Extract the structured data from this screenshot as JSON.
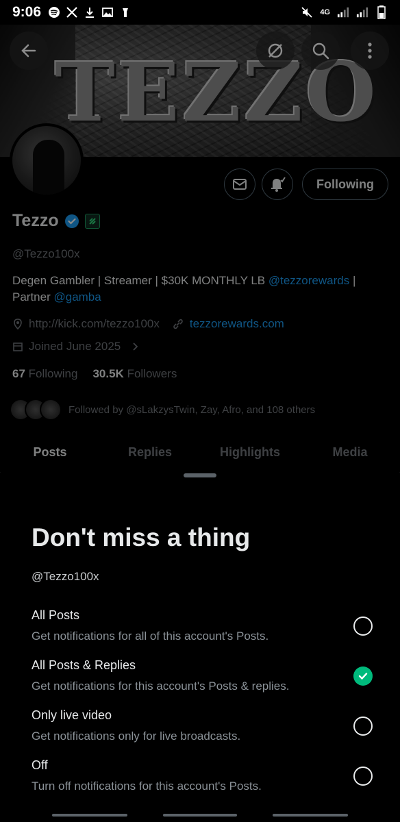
{
  "status_bar": {
    "time": "9:06",
    "network": "4G"
  },
  "profile": {
    "name": "Tezzo",
    "handle": "@Tezzo100x",
    "banner_text": "TEZZO",
    "following_button": "Following",
    "bio_text_1": "Degen Gambler | Streamer | $30K MONTHLY LB ",
    "bio_link_1": "@tezzorewards",
    "bio_text_2": " | Partner ",
    "bio_link_2": "@gamba",
    "url": "http://kick.com/tezzo100x",
    "website": "tezzorewards.com",
    "joined": "Joined June 2025",
    "following_count": "67",
    "following_label": "Following",
    "followers_count": "30.5K",
    "followers_label": "Followers",
    "followed_by": "Followed by @sLakzysTwin, Zay, Afro, and 108 others"
  },
  "tabs": [
    {
      "label": "Posts",
      "active": true
    },
    {
      "label": "Replies",
      "active": false
    },
    {
      "label": "Highlights",
      "active": false
    },
    {
      "label": "Media",
      "active": false
    }
  ],
  "sheet": {
    "title": "Don't miss a thing",
    "subtitle": "@Tezzo100x",
    "options": [
      {
        "title": "All Posts",
        "desc": "Get notifications for all of this account's Posts.",
        "selected": false
      },
      {
        "title": "All Posts & Replies",
        "desc": "Get notifications for this account's Posts & replies.",
        "selected": true
      },
      {
        "title": "Only live video",
        "desc": "Get notifications only for live broadcasts.",
        "selected": false
      },
      {
        "title": "Off",
        "desc": "Turn off notifications for this account's Posts.",
        "selected": false
      }
    ]
  },
  "colors": {
    "accent_link": "#1d9bf0",
    "selected_green": "#00ba7c",
    "verified_blue": "#1d9bf0"
  }
}
